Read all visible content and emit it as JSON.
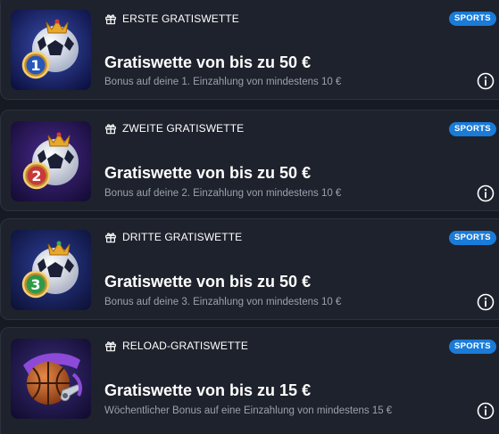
{
  "colors": {
    "page_background": "#161a22",
    "card_background": "#1e222c",
    "badge_background": "#1a7bd8",
    "subtitle_text": "#9aa1ad"
  },
  "offers": [
    {
      "heading": "ERSTE GRATISWETTE",
      "heading_icon": "gift-icon",
      "badge": "SPORTS",
      "title": "Gratiswette von bis zu 50 €",
      "subtitle": "Bonus auf deine 1. Einzahlung von mindestens 10 €",
      "image": "football-number-1-crown",
      "image_number": "1",
      "info_icon": "info-icon"
    },
    {
      "heading": "ZWEITE GRATISWETTE",
      "heading_icon": "gift-icon",
      "badge": "SPORTS",
      "title": "Gratiswette von bis zu 50 €",
      "subtitle": "Bonus auf deine 2. Einzahlung von mindestens 10 €",
      "image": "football-number-2-crown",
      "image_number": "2",
      "info_icon": "info-icon"
    },
    {
      "heading": "DRITTE GRATISWETTE",
      "heading_icon": "gift-icon",
      "badge": "SPORTS",
      "title": "Gratiswette von bis zu 50 €",
      "subtitle": "Bonus auf deine 3. Einzahlung von mindestens 10 €",
      "image": "football-number-3-crown",
      "image_number": "3",
      "info_icon": "info-icon"
    },
    {
      "heading": "RELOAD-GRATISWETTE",
      "heading_icon": "gift-icon",
      "badge": "SPORTS",
      "title": "Gratiswette von bis zu 15 €",
      "subtitle": "Wöchentlicher Bonus auf eine Einzahlung von mindestens 15 €",
      "image": "basketball-whistle",
      "info_icon": "info-icon"
    }
  ]
}
